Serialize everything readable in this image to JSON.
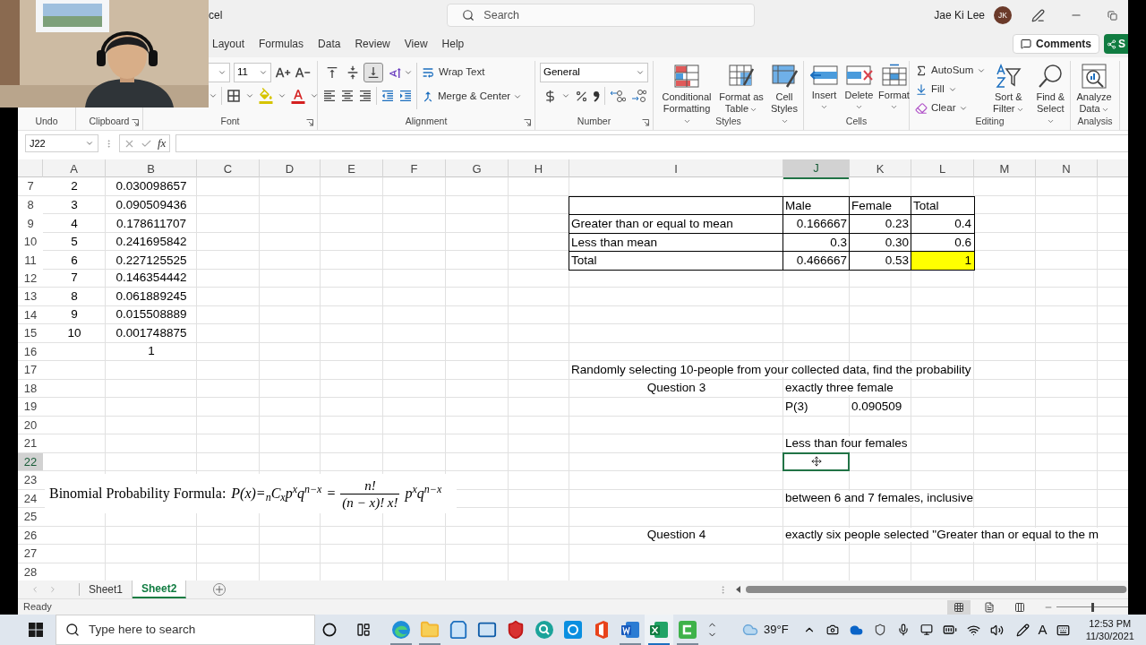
{
  "title_bar": {
    "title": "cel",
    "search_placeholder": "Search",
    "user_name": "Jae Ki Lee",
    "user_initials": "JK"
  },
  "ribbon_tabs": [
    "Layout",
    "Formulas",
    "Data",
    "Review",
    "View",
    "Help"
  ],
  "comments_button": "Comments",
  "share_button": "S",
  "ribbon": {
    "groups": [
      {
        "label": "Undo"
      },
      {
        "label": "Clipboard"
      },
      {
        "label": "Font",
        "font_size": "11"
      },
      {
        "label": "Alignment",
        "vertical_align": [
          {
            "selected": false
          },
          {
            "selected": false
          },
          {
            "selected": true
          }
        ],
        "wrap_text": "Wrap Text",
        "merge_center": "Merge & Center"
      },
      {
        "label": "Number",
        "number_format": "General"
      },
      {
        "label": "Styles",
        "buttons": [
          "Conditional Formatting",
          "Format as Table",
          "Cell Styles"
        ]
      },
      {
        "label": "Cells",
        "buttons": [
          "Insert",
          "Delete",
          "Format"
        ]
      },
      {
        "label": "Editing",
        "commands": [
          "AutoSum",
          "Fill",
          "Clear"
        ],
        "buttons": [
          "Sort & Filter",
          "Find & Select"
        ]
      },
      {
        "label": "Analysis",
        "buttons": [
          "Analyze Data"
        ]
      }
    ]
  },
  "formula_bar": {
    "name_box": "J22",
    "function_label": "fx"
  },
  "sheet": {
    "columns": [
      {
        "label": "A",
        "selected": false
      },
      {
        "label": "B",
        "selected": false
      },
      {
        "label": "C",
        "selected": false
      },
      {
        "label": "D",
        "selected": false
      },
      {
        "label": "E",
        "selected": false
      },
      {
        "label": "F",
        "selected": false
      },
      {
        "label": "G",
        "selected": false
      },
      {
        "label": "H",
        "selected": false
      },
      {
        "label": "I",
        "selected": false
      },
      {
        "label": "J",
        "selected": true
      },
      {
        "label": "K",
        "selected": false
      },
      {
        "label": "L",
        "selected": false
      },
      {
        "label": "M",
        "selected": false
      },
      {
        "label": "N",
        "selected": false
      }
    ],
    "rows": [
      {
        "number": "7",
        "selected": false,
        "cells": {
          "A": {
            "text": "2",
            "kind": "index",
            "boxed": false,
            "highlighted": false
          },
          "B": {
            "text": "0.030098657",
            "kind": "index",
            "boxed": false,
            "highlighted": false
          }
        }
      },
      {
        "number": "8",
        "selected": false,
        "cells": {
          "A": {
            "text": "3",
            "kind": "index",
            "boxed": false,
            "highlighted": false
          },
          "B": {
            "text": "0.090509436",
            "kind": "index",
            "boxed": false,
            "highlighted": false
          },
          "I": {
            "kind": "label",
            "boxed": true,
            "highlighted": false
          },
          "J": {
            "text": "Male",
            "kind": "label",
            "boxed": true,
            "highlighted": false
          },
          "K": {
            "text": "Female",
            "kind": "label",
            "boxed": true,
            "highlighted": false
          },
          "L": {
            "text": "Total",
            "kind": "label",
            "boxed": true,
            "highlighted": false
          }
        }
      },
      {
        "number": "9",
        "selected": false,
        "cells": {
          "A": {
            "text": "4",
            "kind": "index",
            "boxed": false,
            "highlighted": false
          },
          "B": {
            "text": "0.178611707",
            "kind": "index",
            "boxed": false,
            "highlighted": false
          },
          "I": {
            "text": "Greater than or equal to mean",
            "kind": "label",
            "boxed": true,
            "highlighted": false
          },
          "J": {
            "text": "0.166667",
            "kind": "number",
            "boxed": true,
            "highlighted": false
          },
          "K": {
            "text": "0.23",
            "kind": "number",
            "boxed": true,
            "highlighted": false
          },
          "L": {
            "text": "0.4",
            "kind": "number",
            "boxed": true,
            "highlighted": false
          }
        }
      },
      {
        "number": "10",
        "selected": false,
        "cells": {
          "A": {
            "text": "5",
            "kind": "index",
            "boxed": false,
            "highlighted": false
          },
          "B": {
            "text": "0.241695842",
            "kind": "index",
            "boxed": false,
            "highlighted": false
          },
          "I": {
            "text": "Less than mean",
            "kind": "label",
            "boxed": true,
            "highlighted": false
          },
          "J": {
            "text": "0.3",
            "kind": "number",
            "boxed": true,
            "highlighted": false
          },
          "K": {
            "text": "0.30",
            "kind": "number",
            "boxed": true,
            "highlighted": false
          },
          "L": {
            "text": "0.6",
            "kind": "number",
            "boxed": true,
            "highlighted": false
          }
        }
      },
      {
        "number": "11",
        "selected": false,
        "cells": {
          "A": {
            "text": "6",
            "kind": "index",
            "boxed": false,
            "highlighted": false
          },
          "B": {
            "text": "0.227125525",
            "kind": "index",
            "boxed": false,
            "highlighted": false
          },
          "I": {
            "text": "Total",
            "kind": "label",
            "boxed": true,
            "highlighted": false
          },
          "J": {
            "text": "0.466667",
            "kind": "number",
            "boxed": true,
            "highlighted": false
          },
          "K": {
            "text": "0.53",
            "kind": "number",
            "boxed": true,
            "highlighted": false
          },
          "L": {
            "text": "1",
            "kind": "number",
            "boxed": true,
            "highlighted": true
          }
        }
      },
      {
        "number": "12",
        "selected": false,
        "cells": {
          "A": {
            "text": "7",
            "kind": "index",
            "boxed": false,
            "highlighted": false
          },
          "B": {
            "text": "0.146354442",
            "kind": "index",
            "boxed": false,
            "highlighted": false
          }
        }
      },
      {
        "number": "13",
        "selected": false,
        "cells": {
          "A": {
            "text": "8",
            "kind": "index",
            "boxed": false,
            "highlighted": false
          },
          "B": {
            "text": "0.061889245",
            "kind": "index",
            "boxed": false,
            "highlighted": false
          }
        }
      },
      {
        "number": "14",
        "selected": false,
        "cells": {
          "A": {
            "text": "9",
            "kind": "index",
            "boxed": false,
            "highlighted": false
          },
          "B": {
            "text": "0.015508889",
            "kind": "index",
            "boxed": false,
            "highlighted": false
          }
        }
      },
      {
        "number": "15",
        "selected": false,
        "cells": {
          "A": {
            "text": "10",
            "kind": "index",
            "boxed": false,
            "highlighted": false
          },
          "B": {
            "text": "0.001748875",
            "kind": "index",
            "boxed": false,
            "highlighted": false
          }
        }
      },
      {
        "number": "16",
        "selected": false,
        "cells": {
          "B": {
            "text": "1",
            "kind": "index",
            "boxed": false,
            "highlighted": false
          }
        }
      },
      {
        "number": "17",
        "selected": false,
        "cells": {
          "I": {
            "text": "Randomly selecting 10-people from your collected data, find the probability",
            "kind": "label",
            "boxed": false,
            "highlighted": false
          }
        }
      },
      {
        "number": "18",
        "selected": false,
        "cells": {
          "I": {
            "text": "Question 3",
            "kind": "question",
            "boxed": false,
            "highlighted": false
          },
          "J": {
            "text": "exactly three female",
            "kind": "label",
            "boxed": false,
            "highlighted": false
          }
        }
      },
      {
        "number": "19",
        "selected": false,
        "cells": {
          "J": {
            "text": "P(3)",
            "kind": "label",
            "boxed": false,
            "highlighted": false
          },
          "K": {
            "text": "0.090509",
            "kind": "label",
            "boxed": false,
            "highlighted": false
          }
        }
      },
      {
        "number": "20",
        "selected": false
      },
      {
        "number": "21",
        "selected": false,
        "cells": {
          "J": {
            "text": "Less than four females",
            "kind": "label",
            "boxed": false,
            "highlighted": false
          }
        }
      },
      {
        "number": "22",
        "selected": true
      },
      {
        "number": "23",
        "selected": false
      },
      {
        "number": "24",
        "selected": false,
        "cells": {
          "J": {
            "text": "between 6 and 7 females, inclusive",
            "kind": "label",
            "boxed": false,
            "highlighted": false
          }
        }
      },
      {
        "number": "25",
        "selected": false
      },
      {
        "number": "26",
        "selected": false,
        "cells": {
          "I": {
            "text": "Question 4",
            "kind": "question",
            "boxed": false,
            "highlighted": false
          },
          "J": {
            "text": "exactly six people selected \"Greater than or equal to the m",
            "kind": "label",
            "boxed": false,
            "highlighted": false
          }
        }
      },
      {
        "number": "27",
        "selected": false
      },
      {
        "number": "28",
        "selected": false
      }
    ]
  },
  "formula_image": {
    "label": "Binomial Probability Formula:",
    "lhs": "P(x)=$_{n}$C$_{x}$p$^{x}$q$^{n−x}$",
    "equals": "=",
    "numerator": "n!",
    "denominator": "(n − x)! x!",
    "rhs": "p$^{x}$q$^{n−x}$"
  },
  "sheet_tabs": [
    {
      "label": "Sheet1",
      "selected": false
    },
    {
      "label": "Sheet2",
      "selected": true
    }
  ],
  "status_bar": {
    "status": "Ready",
    "views": [
      {
        "selected": true
      },
      {
        "selected": false
      },
      {
        "selected": false
      }
    ],
    "zoom_slider": {
      "level": 0.5
    }
  },
  "taskbar": {
    "search_placeholder": "Type here to search",
    "apps": [
      {
        "kind": "edge",
        "running": true,
        "selected": false
      },
      {
        "kind": "explorer",
        "running": true,
        "selected": false
      },
      {
        "kind": "store",
        "running": false,
        "selected": false
      },
      {
        "kind": "mail",
        "running": false,
        "selected": false
      },
      {
        "kind": "shield",
        "running": false,
        "selected": false
      },
      {
        "kind": "lens",
        "running": false,
        "selected": false
      },
      {
        "kind": "square",
        "running": false,
        "selected": false
      },
      {
        "kind": "office",
        "running": false,
        "selected": false
      },
      {
        "kind": "word",
        "running": true,
        "selected": false
      },
      {
        "kind": "excel",
        "running": true,
        "selected": true
      },
      {
        "kind": "recorder",
        "running": true,
        "selected": false
      }
    ],
    "temperature": "39°F",
    "input_indicator": "A",
    "time": "12:53 PM",
    "date": "11/30/2021"
  }
}
